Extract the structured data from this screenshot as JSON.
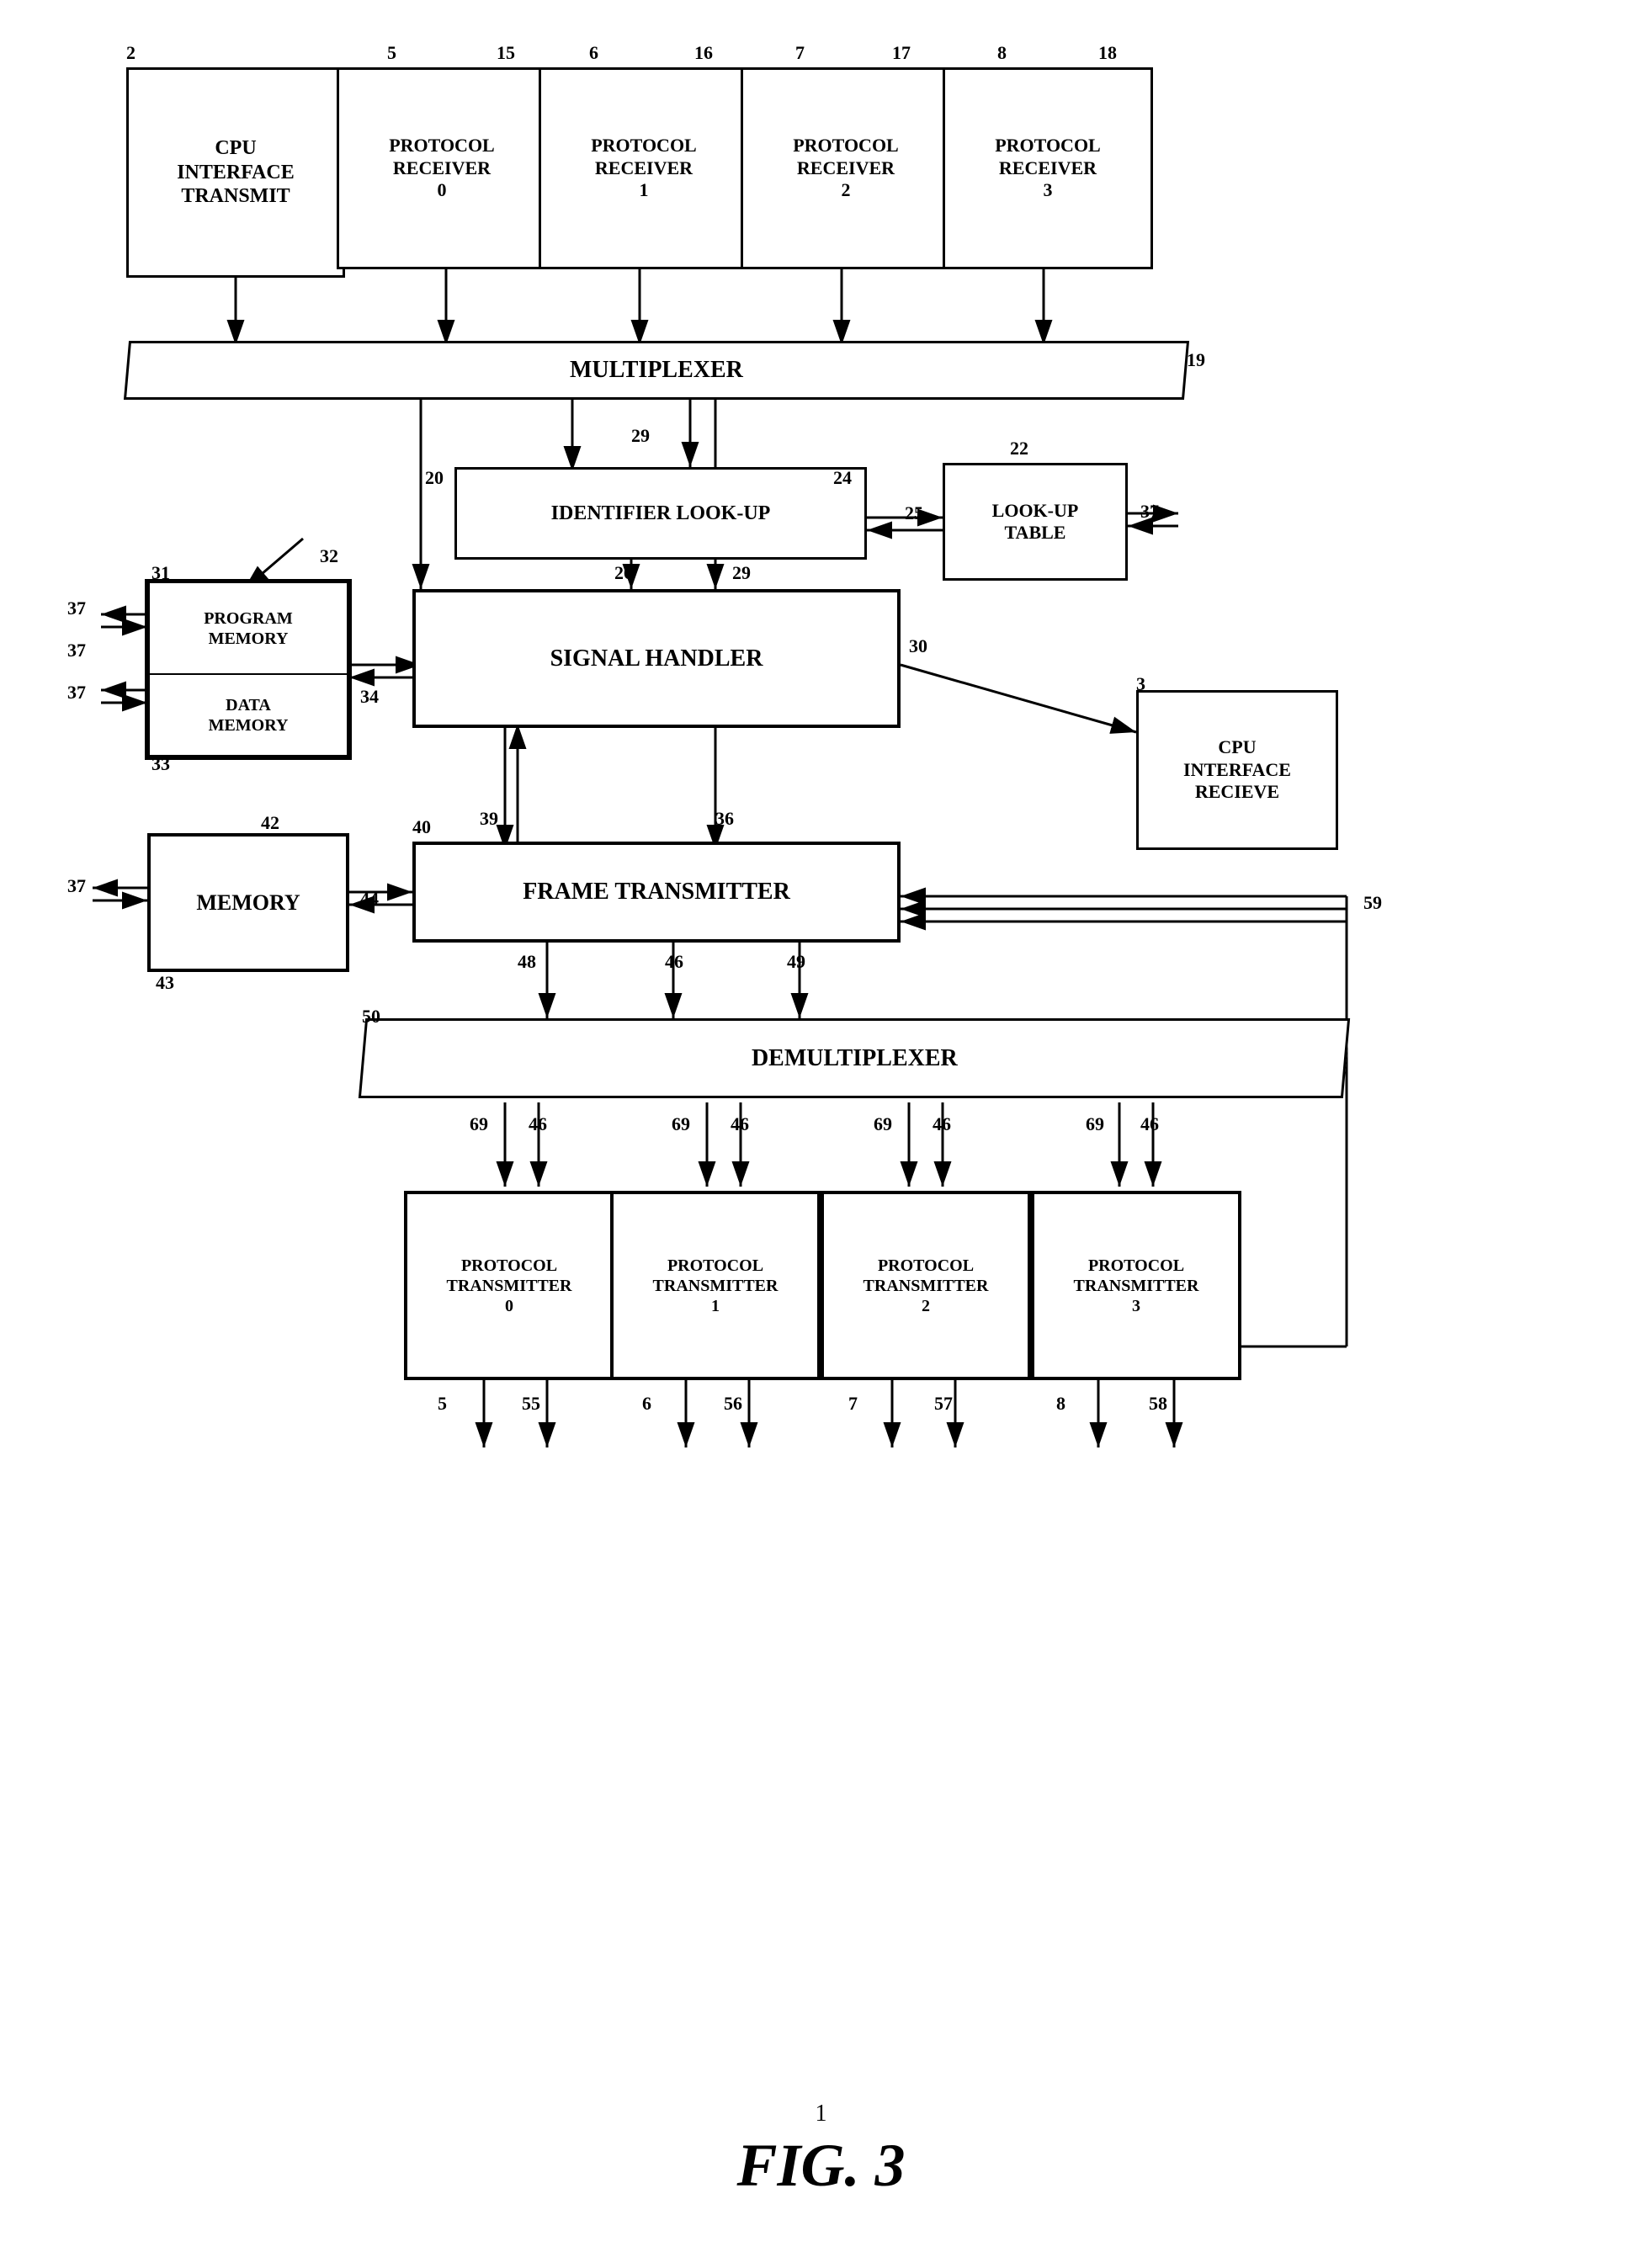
{
  "title": "FIG. 3",
  "figure_number": "1",
  "blocks": {
    "cpu_transmit": {
      "label": "CPU\nINTERFACE\nTRANSMIT",
      "ref": "2"
    },
    "proto_rcv_0": {
      "label": "PROTOCOL\nRECEIVER\n0",
      "ref_top": "5",
      "ref_right": "15"
    },
    "proto_rcv_1": {
      "label": "PROTOCOL\nRECEIVER\n1",
      "ref_top": "6",
      "ref_right": "16"
    },
    "proto_rcv_2": {
      "label": "PROTOCOL\nRECEIVER\n2",
      "ref_top": "7",
      "ref_right": "17"
    },
    "proto_rcv_3": {
      "label": "PROTOCOL\nRECEIVER\n3",
      "ref_top": "8",
      "ref_right": "18"
    },
    "multiplexer": {
      "label": "MULTIPLEXER",
      "ref": "19"
    },
    "identifier_lookup": {
      "label": "IDENTIFIER LOOK-UP",
      "ref_tl": "20",
      "ref_tr": "29",
      "ref_br": "24"
    },
    "lookup_table": {
      "label": "LOOK-UP\nTABLE",
      "ref_top": "22",
      "ref_right": "37"
    },
    "program_memory": {
      "label": "PROGRAM\nMEMORY",
      "ref": "31"
    },
    "data_memory": {
      "label": "DATA\nMEMORY",
      "ref": "33"
    },
    "signal_handler": {
      "label": "SIGNAL HANDLER",
      "ref": "30",
      "ref_in": "26",
      "ref_in2": "29"
    },
    "cpu_receive": {
      "label": "CPU\nINTERFACE\nRECIEVE",
      "ref": "3"
    },
    "memory": {
      "label": "MEMORY",
      "ref": "43",
      "ref_top": "42"
    },
    "frame_transmitter": {
      "label": "FRAME TRANSMITTER",
      "ref": "40"
    },
    "demultiplexer": {
      "label": "DEMULTIPLEXER",
      "ref": "50"
    },
    "proto_tx_0": {
      "label": "PROTOCOL\nTRANSMITTER\n0",
      "ref_top_l": "5",
      "ref_bot_r": "55"
    },
    "proto_tx_1": {
      "label": "PROTOCOL\nTRANSMITTER\n1",
      "ref_top_l": "6",
      "ref_bot_r": "56"
    },
    "proto_tx_2": {
      "label": "PROTOCOL\nTRANSMITTER\n2",
      "ref_top_l": "7",
      "ref_bot_r": "57"
    },
    "proto_tx_3": {
      "label": "PROTOCOL\nTRANSMITTER\n3",
      "ref_top_l": "8",
      "ref_bot_r": "58"
    }
  },
  "caption": "FIG. 3",
  "caption_ref": "1"
}
